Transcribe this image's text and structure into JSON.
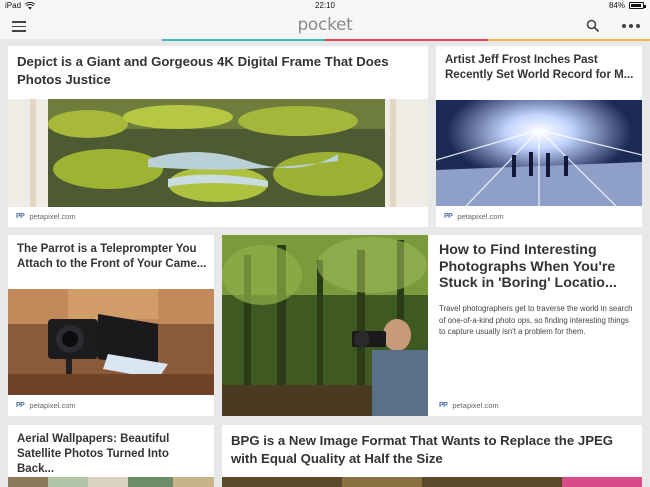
{
  "status": {
    "device": "iPad",
    "time": "22:10",
    "battery": "84%"
  },
  "header": {
    "title": "pocket"
  },
  "accent_colors": [
    "#3bbfb0",
    "#ef4056",
    "#fcb64a",
    "#3bbfb0"
  ],
  "source_logo": "PP",
  "cards": [
    {
      "title": "Depict is a Giant and Gorgeous 4K Digital Frame That Does Photos Justice",
      "source": "petapixel.com"
    },
    {
      "title": "Artist Jeff Frost Inches Past Recently Set World Record for M...",
      "source": "petapixel.com"
    },
    {
      "title": "The Parrot is a Teleprompter You Attach to the Front of Your Came...",
      "source": "petapixel.com"
    },
    {
      "title": "How to Find Interesting Photographs When You're Stuck in 'Boring' Locatio...",
      "excerpt": "Travel photographers get to traverse the world in search of one-of-a-kind photo ops, so finding interesting things to capture usually isn't a problem for them.",
      "source": "petapixel.com"
    },
    {
      "title": "Aerial Wallpapers: Beautiful Satellite Photos Turned Into Back..."
    },
    {
      "title": "BPG is a New Image Format That Wants to Replace the JPEG with Equal Quality at Half the Size"
    }
  ]
}
